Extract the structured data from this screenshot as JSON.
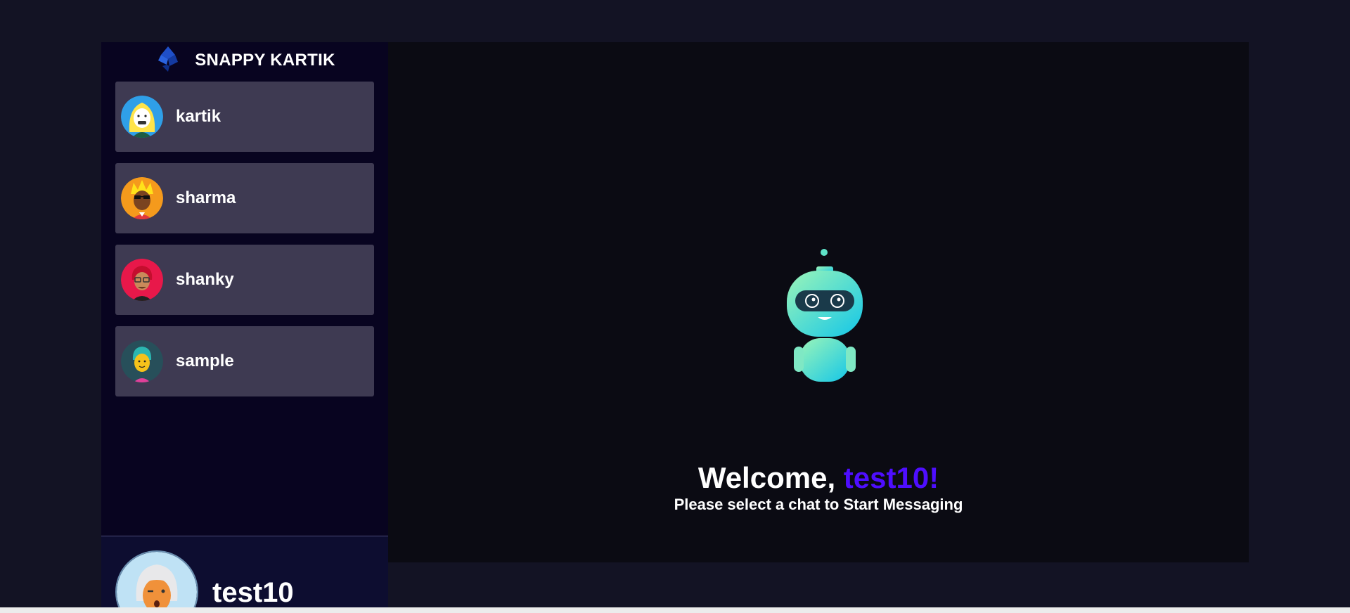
{
  "brand": {
    "title": "SNAPPY KARTIK",
    "logo_icon": "diamond-logo-icon"
  },
  "contacts": [
    {
      "name": "kartik",
      "avatar": "blonde-avatar"
    },
    {
      "name": "sharma",
      "avatar": "spiky-hair-sunglasses-avatar"
    },
    {
      "name": "shanky",
      "avatar": "red-hair-glasses-avatar"
    },
    {
      "name": "sample",
      "avatar": "teal-hair-avatar"
    }
  ],
  "current_user": {
    "name": "test10",
    "avatar": "white-hair-winking-avatar"
  },
  "welcome": {
    "greeting": "Welcome, ",
    "username": "test10!",
    "subtitle": "Please select a chat to Start Messaging",
    "illustration": "robot-illustration"
  },
  "colors": {
    "background": "#131324",
    "sidebar": "#080420",
    "contact_card": "#3e3a52",
    "accent": "#4e0eff",
    "main_panel": "#0b0b13"
  }
}
